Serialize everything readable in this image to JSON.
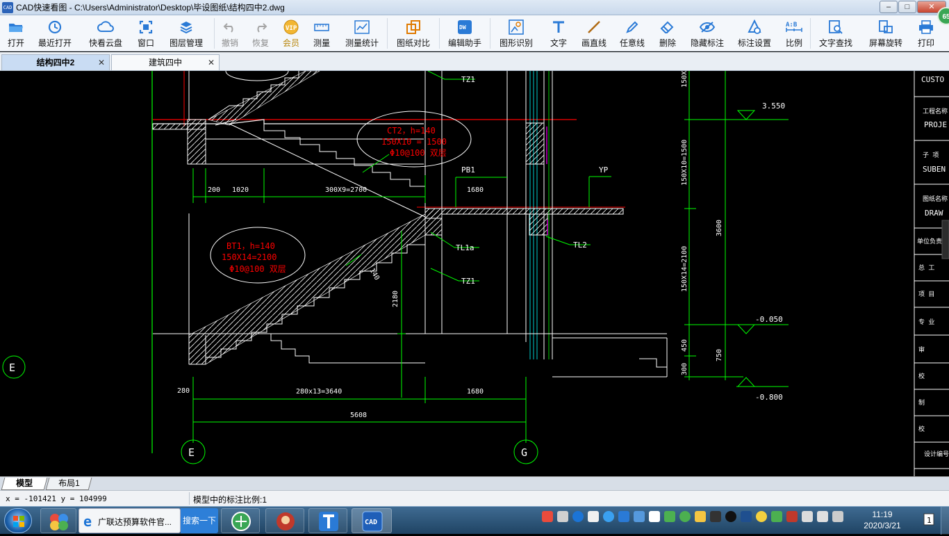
{
  "window": {
    "app_icon_text": "CAD",
    "title": "CAD快速看图 - C:\\Users\\Administrator\\Desktop\\毕设图纸\\结构四中2.dwg",
    "buttons": [
      "–",
      "□",
      "✕"
    ]
  },
  "toolbar": {
    "items": [
      {
        "label": "打开",
        "icon": "folder-open-icon",
        "state": "normal"
      },
      {
        "label": "最近打开",
        "icon": "recent-clock-icon",
        "state": "normal"
      },
      {
        "label": "快看云盘",
        "icon": "cloud-icon",
        "state": "normal"
      },
      {
        "label": "窗口",
        "icon": "window-frame-icon",
        "state": "normal"
      },
      {
        "label": "图层管理",
        "icon": "layers-icon",
        "state": "normal"
      },
      {
        "label": "撤销",
        "icon": "undo-icon",
        "state": "disabled"
      },
      {
        "label": "恢复",
        "icon": "redo-icon",
        "state": "disabled"
      },
      {
        "label": "会员",
        "icon": "vip-icon",
        "state": "vip"
      },
      {
        "label": "测量",
        "icon": "ruler-icon",
        "state": "normal"
      },
      {
        "label": "测量统计",
        "icon": "measure-stats-icon",
        "state": "normal"
      },
      {
        "label": "图纸对比",
        "icon": "compare-icon",
        "state": "normal"
      },
      {
        "label": "编辑助手",
        "icon": "edit-helper-icon",
        "state": "normal"
      },
      {
        "label": "图形识别",
        "icon": "shape-recognize-icon",
        "state": "normal"
      },
      {
        "label": "文字",
        "icon": "text-t-icon",
        "state": "normal"
      },
      {
        "label": "画直线",
        "icon": "line-icon",
        "state": "normal"
      },
      {
        "label": "任意线",
        "icon": "pen-icon",
        "state": "normal"
      },
      {
        "label": "删除",
        "icon": "eraser-icon",
        "state": "normal"
      },
      {
        "label": "隐藏标注",
        "icon": "eye-hide-icon",
        "state": "normal"
      },
      {
        "label": "标注设置",
        "icon": "annotation-settings-icon",
        "state": "normal"
      },
      {
        "label": "比例",
        "icon": "scale-ab-icon",
        "state": "normal"
      },
      {
        "label": "文字查找",
        "icon": "text-search-icon",
        "state": "normal"
      },
      {
        "label": "屏幕旋转",
        "icon": "rotate-screen-icon",
        "state": "normal"
      },
      {
        "label": "打印",
        "icon": "printer-icon",
        "state": "normal"
      }
    ],
    "badge": "65"
  },
  "doc_tabs": [
    {
      "label": "结构四中2",
      "active": true
    },
    {
      "label": "建筑四中",
      "active": false
    }
  ],
  "drawing": {
    "labels": {
      "ct2_line1": "CT2，h=140",
      "ct2_line2": "150X10  = 1500",
      "ct2_line3": "Φ10@100  双层",
      "bt1_line1": "BT1，h=140",
      "bt1_line2": "150X14=2100",
      "bt1_line3": "Φ10@100  双层",
      "tz1_top": "TZ1",
      "tz1_mid": "TZ1",
      "pb1": "PB1",
      "yp": "YP",
      "tl1a": "TL1a",
      "tl2": "TL2",
      "dim_200": "200",
      "dim_1020": "1020",
      "dim_300x9": "300X9=2700",
      "dim_1680_top": "1680",
      "dim_2180": "2180",
      "dim_140": "140",
      "dim_280": "280",
      "dim_280x13": "280x13=3640",
      "dim_1680_bot": "1680",
      "dim_5608": "5608",
      "dim_150x10": "150X10=1500",
      "dim_150x14": "150X14=2100",
      "dim_3600": "3600",
      "dim_150x": "150X",
      "dim_450": "450",
      "dim_300": "300",
      "dim_750": "750",
      "elev_3550": "3.550",
      "elev_m0050": "-0.050",
      "elev_m0800": "-0.800",
      "axis_e_left": "E",
      "axis_e": "E",
      "axis_g": "G"
    },
    "title_block": [
      "CUSTO",
      "工程名称",
      "PROJE",
      "子  项",
      "SUBEN",
      "图纸名称",
      "DRAW",
      "单位负责",
      "总  工",
      "项  目",
      "专  业",
      "审",
      "校",
      "制",
      "校",
      "设计编号"
    ]
  },
  "layout_tabs": [
    {
      "label": "模型",
      "active": true
    },
    {
      "label": "布局1",
      "active": false
    }
  ],
  "status": {
    "coords": "x = -101421  y = 104999",
    "scale": "模型中的标注比例:1"
  },
  "taskbar": {
    "ie_title": "广联达预算软件官...",
    "search_btn": "搜索一下",
    "time": "11:19",
    "date": "2020/3/21",
    "notif_count": "1"
  },
  "colors": {
    "green": "#00ff00",
    "red": "#ff0000",
    "white": "#ffffff",
    "magenta": "#ff00ff",
    "cyan": "#00ffff"
  }
}
